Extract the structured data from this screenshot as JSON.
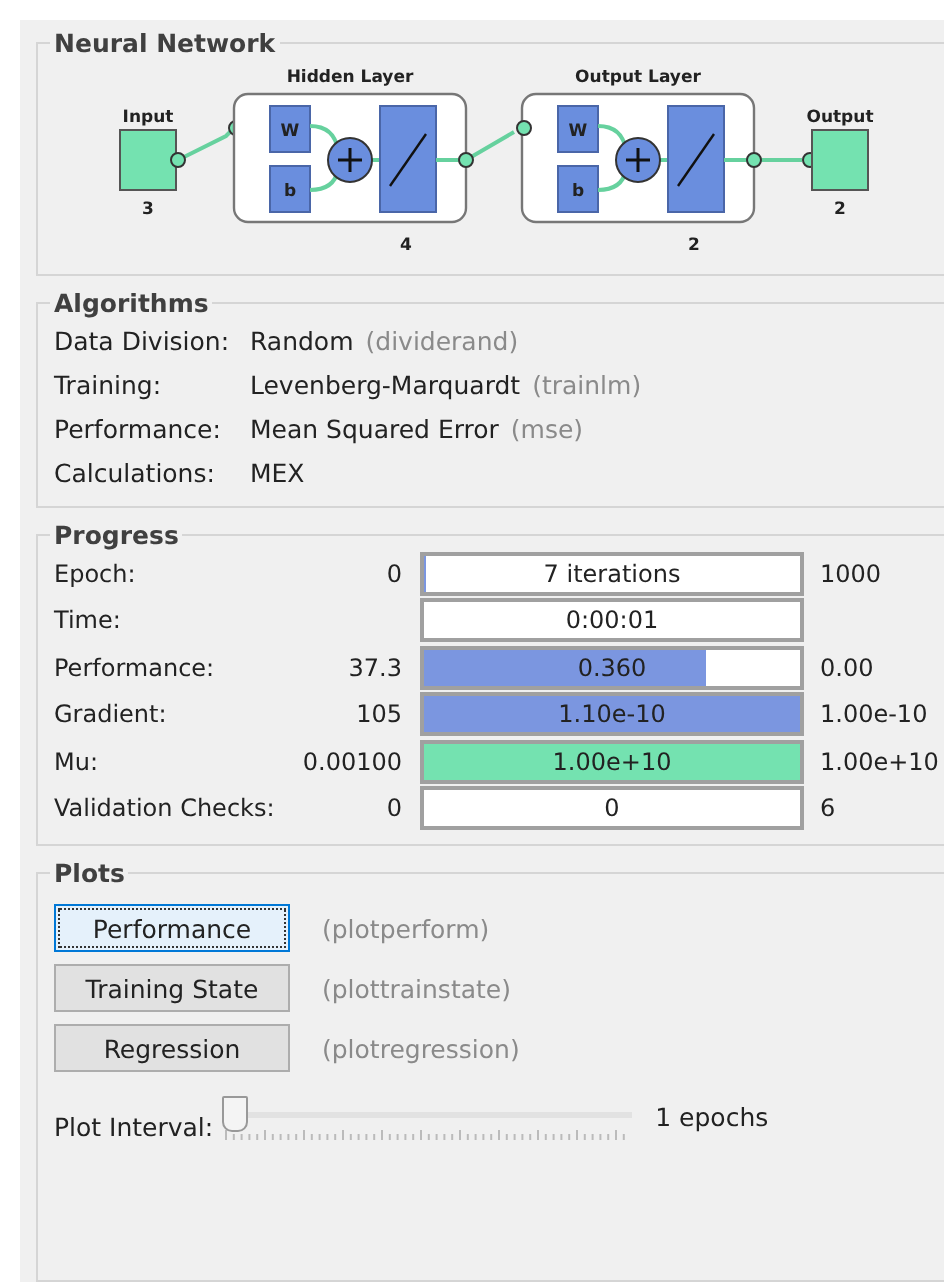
{
  "network": {
    "title": "Neural Network",
    "input": {
      "label": "Input",
      "size": "3"
    },
    "layers": [
      {
        "title": "Hidden Layer",
        "weight": "W",
        "bias": "b",
        "size": "4"
      },
      {
        "title": "Output Layer",
        "weight": "W",
        "bias": "b",
        "size": "2"
      }
    ],
    "output": {
      "label": "Output",
      "size": "2"
    }
  },
  "algorithms": {
    "title": "Algorithms",
    "rows": [
      {
        "label": "Data Division:",
        "value": "Random",
        "hint": "(dividerand)"
      },
      {
        "label": "Training:",
        "value": "Levenberg-Marquardt",
        "hint": "(trainlm)"
      },
      {
        "label": "Performance:",
        "value": "Mean Squared Error",
        "hint": "(mse)"
      },
      {
        "label": "Calculations:",
        "value": "MEX"
      }
    ]
  },
  "progress": {
    "title": "Progress",
    "rows": [
      {
        "label": "Epoch:",
        "start": "0",
        "value": "7 iterations",
        "end": "1000",
        "level": 0.007
      },
      {
        "label": "Time:",
        "value": "0:00:01"
      },
      {
        "label": "Performance:",
        "start": "37.3",
        "value": "0.360",
        "end": "0.00",
        "level": 0.75,
        "color": "#7b96e0"
      },
      {
        "label": "Gradient:",
        "start": "105",
        "value": "1.10e-10",
        "end": "1.00e-10",
        "level": 1,
        "color": "#7b96e0"
      },
      {
        "label": "Mu:",
        "start": "0.00100",
        "value": "1.00e+10",
        "end": "1.00e+10",
        "level": 1,
        "color": "#74e2b0"
      },
      {
        "label": "Validation Checks:",
        "start": "0",
        "value": "0",
        "end": "6"
      }
    ]
  },
  "plots": {
    "title": "Plots",
    "buttons": [
      {
        "label": "Performance",
        "hint": "(plotperform)",
        "focused": true
      },
      {
        "label": "Training State",
        "hint": "(plottrainstate)",
        "focused": false
      },
      {
        "label": "Regression",
        "hint": "(plotregression)",
        "focused": false
      }
    ],
    "interval": {
      "label": "Plot Interval:",
      "level": 0,
      "reading": "1 epochs"
    }
  }
}
